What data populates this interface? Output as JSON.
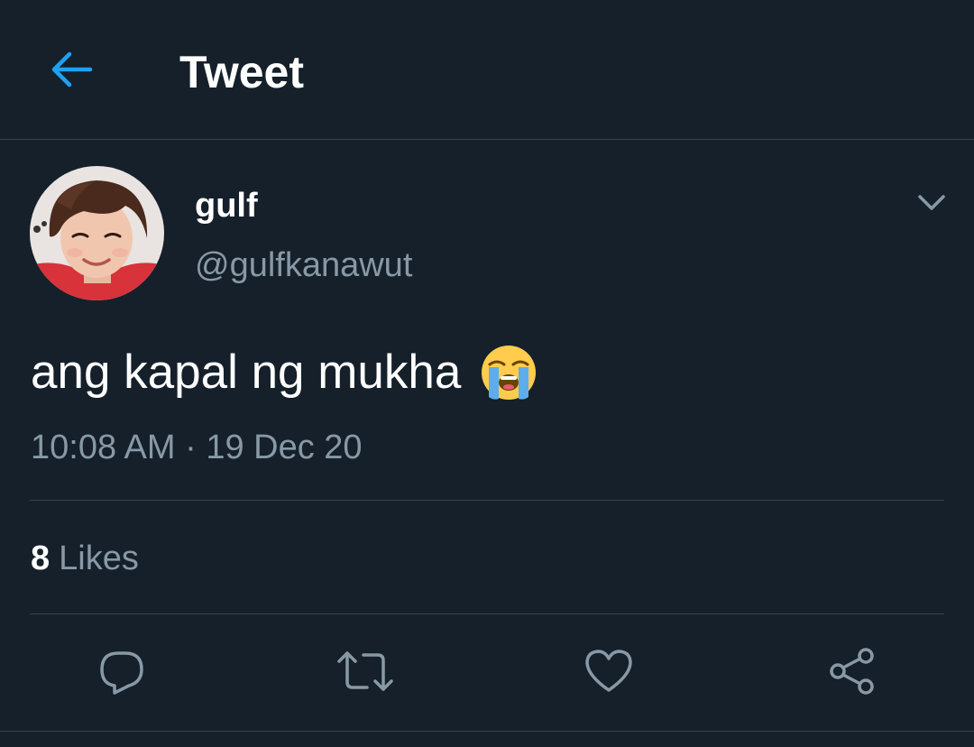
{
  "header": {
    "title": "Tweet",
    "back_icon": "arrow-left-icon"
  },
  "tweet": {
    "author": {
      "display_name": "gulf",
      "handle": "@gulfkanawut"
    },
    "text": "ang kapal ng mukha",
    "emoji": "loudly-crying-face",
    "timestamp": "10:08 AM · 19 Dec 20"
  },
  "stats": {
    "likes_count": "8",
    "likes_label": "Likes"
  },
  "actions": [
    {
      "icon": "reply-icon"
    },
    {
      "icon": "retweet-icon"
    },
    {
      "icon": "like-icon"
    },
    {
      "icon": "share-icon"
    }
  ],
  "colors": {
    "background": "#15202b",
    "accent": "#1da1f2",
    "secondary_text": "#8899a6",
    "divider": "#38444d"
  }
}
